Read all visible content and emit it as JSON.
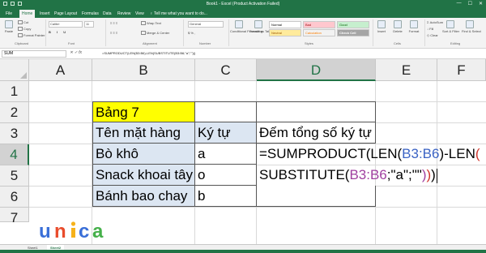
{
  "window": {
    "title": "Book1 - Excel (Product Activation Failed)",
    "controls": [
      "—",
      "☐",
      "✕"
    ]
  },
  "ribbon_tabs": [
    "File",
    "Home",
    "Insert",
    "Page Layout",
    "Formulas",
    "Data",
    "Review",
    "View",
    "♀ Tell me what you want to do..."
  ],
  "ribbon": {
    "cut": "Cut",
    "copy": "Copy",
    "format_painter": "Format Painter",
    "clipboard": "Clipboard",
    "paste": "Paste",
    "font_name": "Calibri",
    "font_size": "11",
    "font": "Font",
    "wrap_text": "Wrap Text",
    "merge_center": "Merge & Center",
    "alignment": "Alignment",
    "number_format": "General",
    "number": "Number",
    "conditional_formatting": "Conditional Formatting",
    "format_as_table": "Format as Table",
    "styles": {
      "normal": "Normal",
      "bad": "Bad",
      "good": "Good",
      "neutral": "Neutral",
      "calculation": "Calculation",
      "check_cell": "Check Cell"
    },
    "styles_label": "Styles",
    "insert": "Insert",
    "delete": "Delete",
    "format": "Format",
    "cells": "Cells",
    "autosum": "AutoSum",
    "fill": "Fill",
    "clear": "Clear",
    "sort_filter": "Sort & Filter",
    "find_select": "Find & Select",
    "editing": "Editing"
  },
  "formula_bar": {
    "name_box": "SUM",
    "formula": "=SUMPRODUCT(LEN(B3:B6)-LEN(SUBSTITUTE(B3:B6;\"a\";\"\")))"
  },
  "columns": [
    "A",
    "B",
    "C",
    "D",
    "E",
    "F"
  ],
  "rows": [
    "1",
    "2",
    "3",
    "4",
    "5",
    "6",
    "7"
  ],
  "cells": {
    "b2": "Bảng 7",
    "b3": "Tên mặt hàng",
    "c3": "Ký tự",
    "d3": "Đếm tổng số ký tự",
    "b4": "Bò khô",
    "c4": "a",
    "b5": "Snack khoai tây",
    "c5": "o",
    "b6": "Bánh bao chay",
    "c6": "b"
  },
  "editing_formula": {
    "line1_prefix": "=SUMPRODUCT(LEN(",
    "line1_ref": "B3:B6",
    "line1_mid": ")-LEN",
    "line1_paren": "(",
    "line2_prefix": "SUBSTITUTE(",
    "line2_ref": "B3:B6",
    "line2_mid": ";\"a\";\"\"",
    "line2_end1": ")",
    "line2_end2": ")",
    "line2_end3": ")"
  },
  "sheet_tabs": [
    "Sheet1",
    "Sheet2"
  ],
  "logo": {
    "brand_colors": {
      "u": "#3a6fd8",
      "n": "#e94c2c",
      "i": "#f6b21b",
      "c": "#3a6fd8",
      "a": "#45b04a"
    }
  },
  "colors": {
    "excel_green": "#217346",
    "yellow_fill": "#ffff00",
    "blue_fill": "#dce6f2"
  }
}
